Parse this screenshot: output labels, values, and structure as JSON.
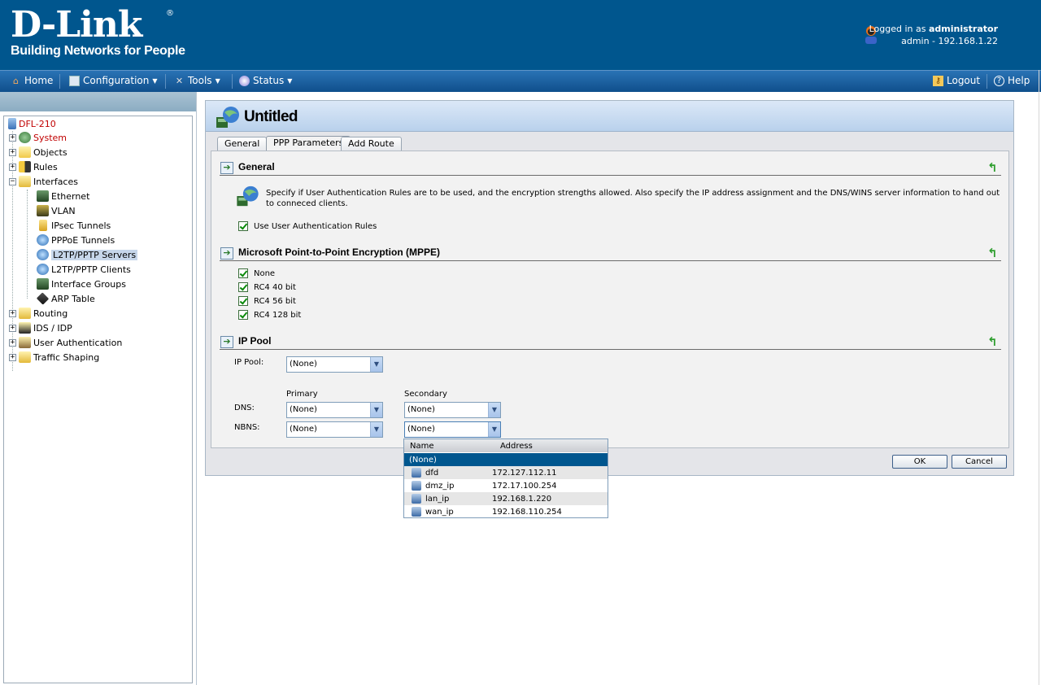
{
  "header": {
    "brand": "D-Link",
    "reg": "®",
    "tagline": "Building Networks for People",
    "logged_prefix": "Logged in as ",
    "logged_user": "administrator",
    "session": "admin - 192.168.1.22"
  },
  "menu": {
    "home": "Home",
    "configuration": "Configuration",
    "tools": "Tools",
    "status": "Status",
    "logout": "Logout",
    "help": "Help"
  },
  "tree": {
    "root": "DFL-210",
    "system": "System",
    "objects": "Objects",
    "rules": "Rules",
    "interfaces": "Interfaces",
    "ethernet": "Ethernet",
    "vlan": "VLAN",
    "ipsec": "IPsec Tunnels",
    "pppoe": "PPPoE Tunnels",
    "l2tp_servers": "L2TP/PPTP Servers",
    "l2tp_clients": "L2TP/PPTP Clients",
    "iface_groups": "Interface Groups",
    "arp": "ARP Table",
    "routing": "Routing",
    "idp": "IDS / IDP",
    "userauth": "User Authentication",
    "shaping": "Traffic Shaping"
  },
  "panel": {
    "title": "Untitled",
    "tabs": [
      "General",
      "PPP Parameters",
      "Add Route"
    ],
    "general_title": "General",
    "description": "Specify if User Authentication Rules are to be used, and the encryption strengths allowed. Also specify the IP address assignment and the DNS/WINS server information to hand out to conneced clients.",
    "use_auth": "Use User Authentication Rules",
    "mppe_title": "Microsoft Point-to-Point Encryption (MPPE)",
    "mppe": [
      "None",
      "RC4 40 bit",
      "RC4 56 bit",
      "RC4 128 bit"
    ],
    "ippool_title": "IP Pool",
    "ippool_label": "IP Pool:",
    "ippool_value": "(None)",
    "primary": "Primary",
    "secondary": "Secondary",
    "dns_label": "DNS:",
    "nbns_label": "NBNS:",
    "dns_primary": "(None)",
    "dns_secondary": "(None)",
    "nbns_primary": "(None)",
    "nbns_secondary": "(None)",
    "ok": "OK",
    "cancel": "Cancel"
  },
  "dropdown": {
    "col_name": "Name",
    "col_address": "Address",
    "selected": "(None)",
    "rows": [
      {
        "name": "dfd",
        "address": "172.127.112.11"
      },
      {
        "name": "dmz_ip",
        "address": "172.17.100.254"
      },
      {
        "name": "lan_ip",
        "address": "192.168.1.220"
      },
      {
        "name": "wan_ip",
        "address": "192.168.110.254"
      }
    ]
  }
}
